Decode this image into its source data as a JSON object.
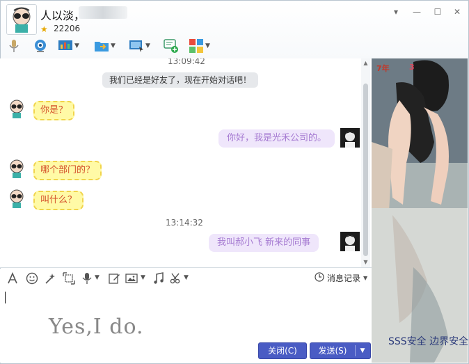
{
  "header": {
    "nickname": "人以淡，",
    "level": "22206"
  },
  "chat": {
    "time_top": "13:09:42",
    "system_msg": "我们已经是好友了，现在开始对话吧！",
    "messages": [
      {
        "side": "left",
        "text": "你是？"
      },
      {
        "side": "right",
        "text": "你好，我是光禾公司的。"
      },
      {
        "side": "left",
        "text": "哪个部门的？"
      },
      {
        "side": "left",
        "text": "叫什么？"
      }
    ],
    "time_mid": "13:14:32",
    "last_msg": "我叫郝小飞   新来的同事"
  },
  "input": {
    "history_label": "消息记录",
    "draft_text": "Yes,I do.",
    "close_label": "关闭(C)",
    "send_label": "发送(S)"
  },
  "side": {
    "badge_years": "7年",
    "badge_hearts": "3",
    "watermark": "SSS安全  边界安全"
  },
  "colors": {
    "button": "#4a5cc4",
    "left_bubble_bg": "#fffaa6",
    "left_bubble_text": "#d4502a",
    "right_bubble_bg": "#efe6fb",
    "right_bubble_text": "#a67bd2"
  }
}
